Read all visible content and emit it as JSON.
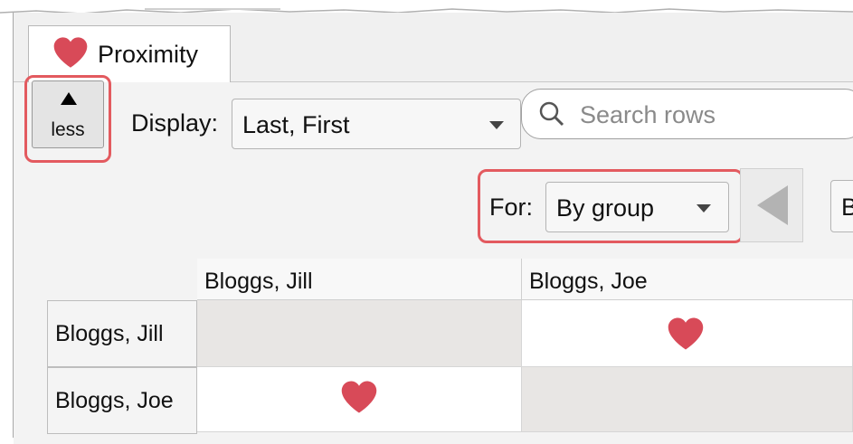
{
  "tab": {
    "label": "Proximity",
    "icon": "heart-icon"
  },
  "toolbar": {
    "less_label": "less",
    "display_label": "Display:",
    "display_value": "Last, First",
    "search_placeholder": "Search rows",
    "for_label": "For:",
    "for_value": "By group",
    "cut_button_label": "B"
  },
  "grid": {
    "columns": [
      "Bloggs, Jill",
      "Bloggs, Joe"
    ],
    "rows": [
      {
        "label": "Bloggs, Jill",
        "cells": [
          "",
          "heart"
        ]
      },
      {
        "label": "Bloggs, Joe",
        "cells": [
          "heart",
          ""
        ]
      }
    ]
  },
  "colors": {
    "heart": "#d84a58",
    "highlight": "#e35a5f",
    "diagonal": "#e8e6e4"
  }
}
